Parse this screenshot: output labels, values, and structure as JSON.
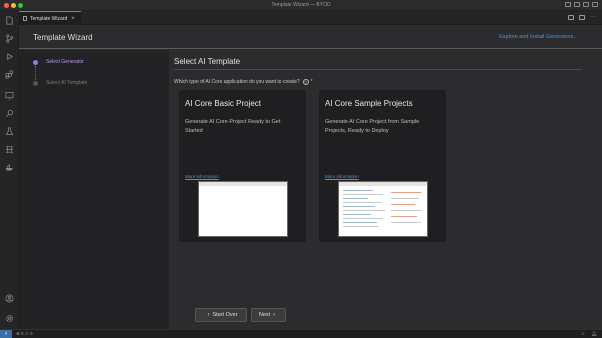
{
  "window": {
    "title": "Template Wizard — BYOD"
  },
  "tab": {
    "label": "Template Wizard",
    "close": "×"
  },
  "wizard": {
    "title": "Template Wizard",
    "explore_link": "Explore and Install Generators..."
  },
  "steps": [
    {
      "label": "Select Generator",
      "state": "active"
    },
    {
      "label": "Select AI Template",
      "state": "inactive"
    }
  ],
  "main": {
    "title": "Select AI Template",
    "question": "Which type of AI Core application do you want to create?",
    "help": "?",
    "required_marker": "*"
  },
  "cards": [
    {
      "title": "AI Core Basic Project",
      "description": "Generate AI Core Project Ready to Get Started",
      "more_info": "More information"
    },
    {
      "title": "AI Core Sample Projects",
      "description": "Generate AI Core Project from Sample Projects, Ready to Deploy",
      "more_info": "More information"
    }
  ],
  "buttons": {
    "start_over": "Start Over",
    "next": "Next"
  },
  "status": {
    "remote": "⚡",
    "left": "⊗ 0 ⚠ 0",
    "right_icons": [
      "bell-icon",
      "feedback-icon"
    ]
  },
  "colors": {
    "accent_purple": "#9a7ad6",
    "link_blue": "#4e94ce",
    "remote_blue": "#3a6ea5"
  }
}
